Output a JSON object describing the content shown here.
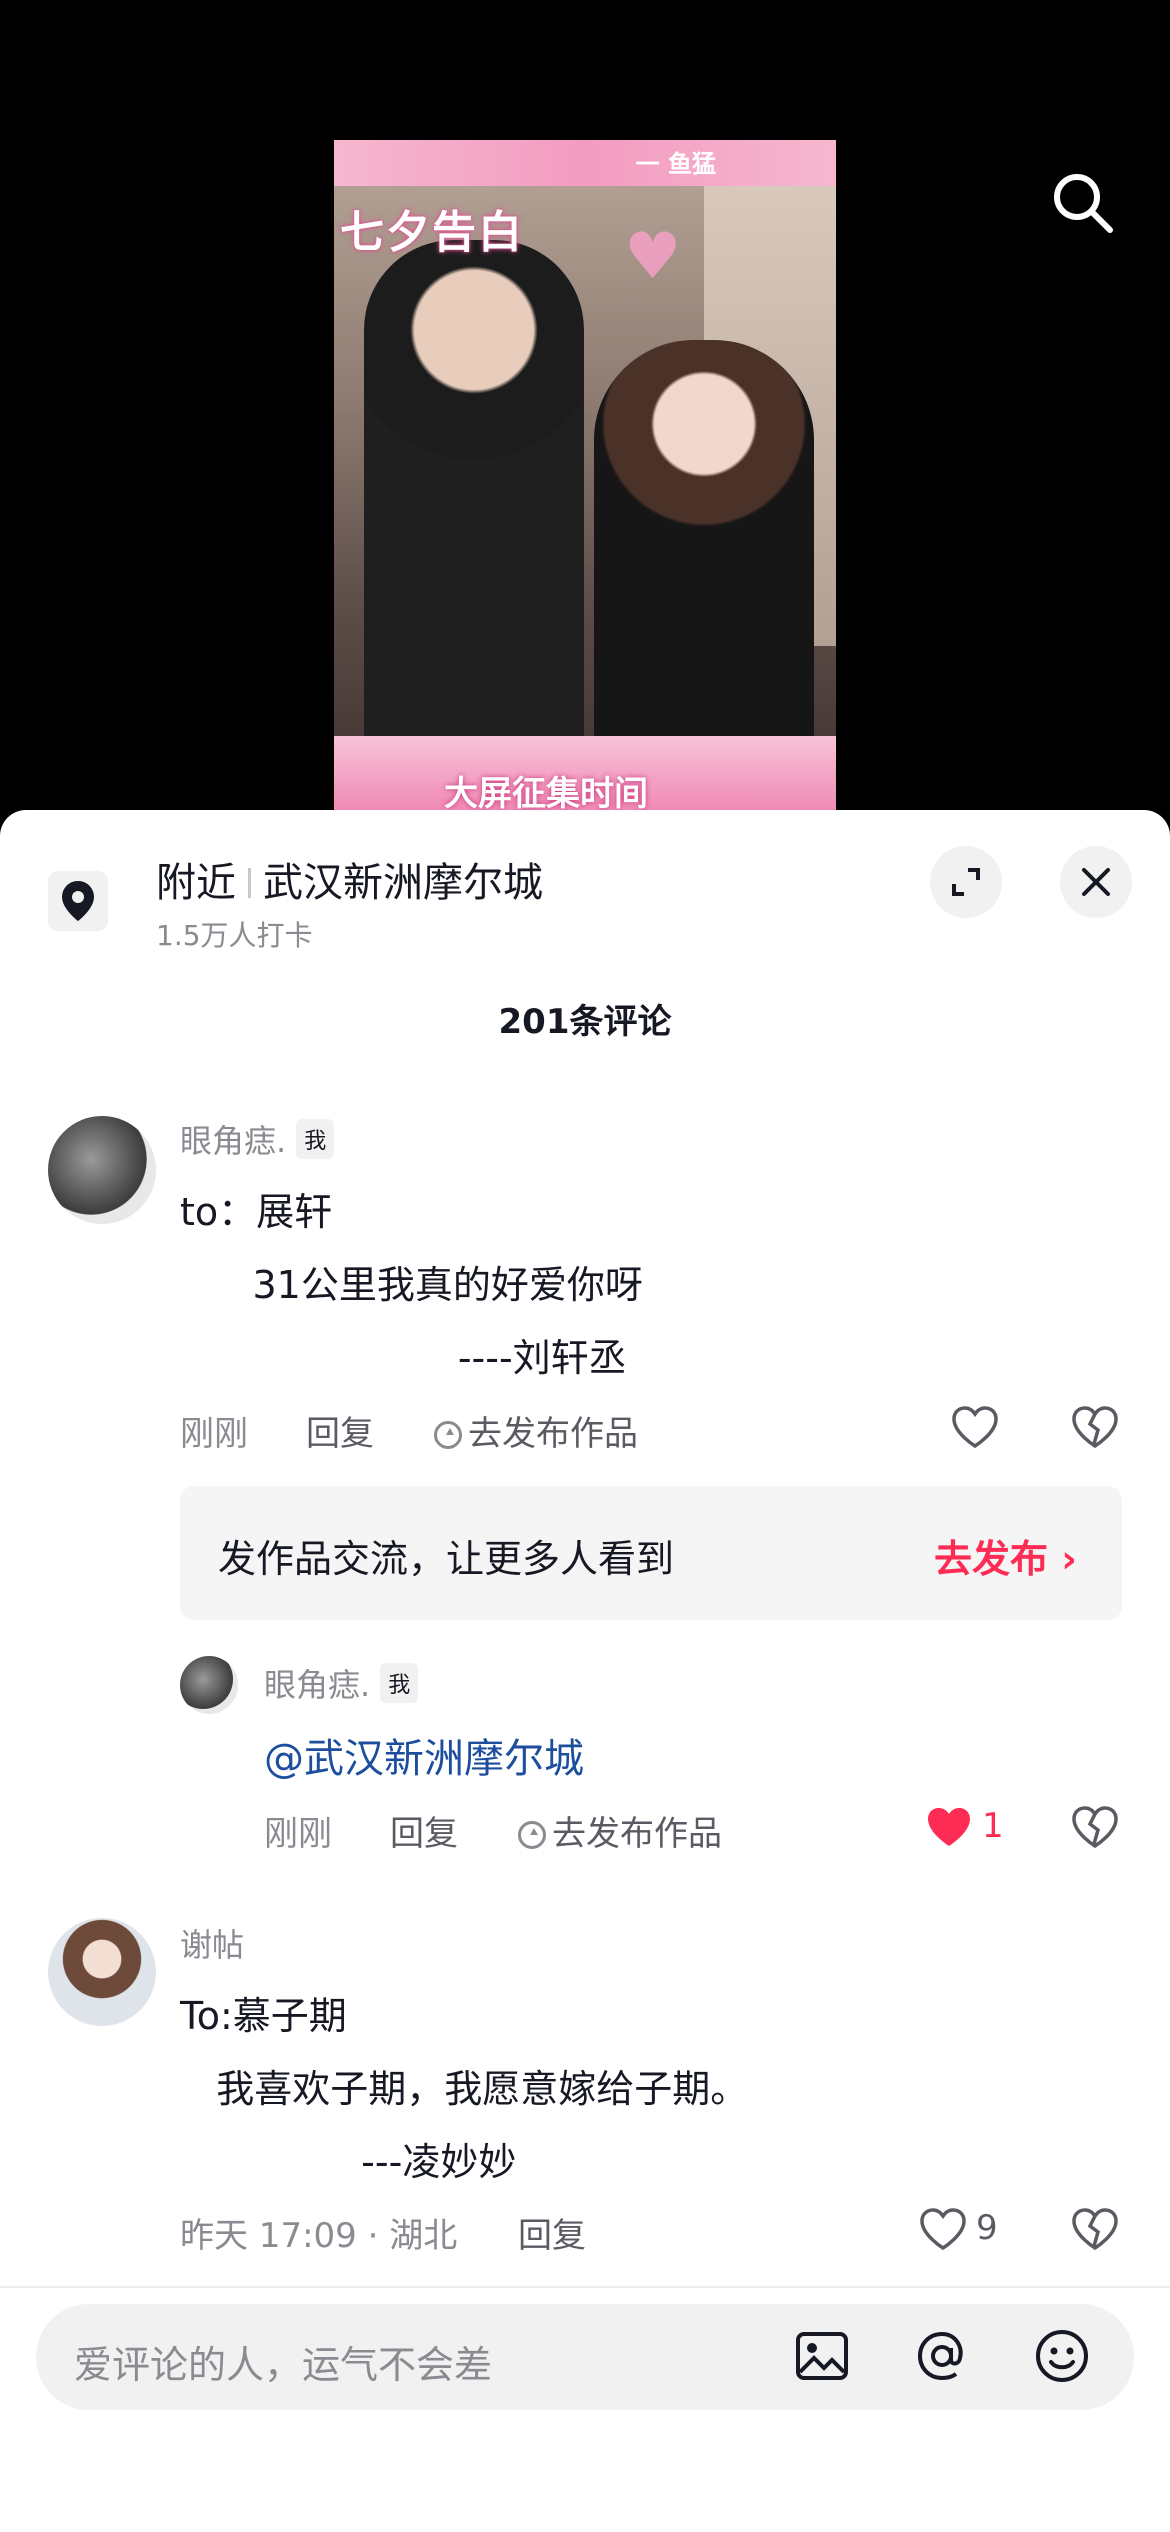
{
  "video": {
    "banner_text": "一 鱼猛",
    "title_text": "七夕告白",
    "bottom_text": "大屏征集时间"
  },
  "location": {
    "prefix": "附近",
    "name": "武汉新洲摩尔城",
    "subtitle": "1.5万人打卡"
  },
  "comments_header": "201条评论",
  "comments": [
    {
      "username": "眼角痣.",
      "badge": "我",
      "lines": [
        "to：展轩",
        "      31公里我真的好爱你呀",
        "                       ----刘轩丞"
      ],
      "time": "刚刚",
      "reply_label": "回复",
      "publish_label": "去发布作品"
    },
    {
      "username": "眼角痣.",
      "badge": "我",
      "mention": "@武汉新洲摩尔城",
      "time": "刚刚",
      "reply_label": "回复",
      "publish_label": "去发布作品",
      "like_count": "1"
    },
    {
      "username": "谢帖",
      "lines": [
        "To:慕子期",
        "   我喜欢子期，我愿意嫁给子期。",
        "               ---凌妙妙"
      ],
      "meta": "昨天 17:09 · 湖北",
      "reply_label": "回复",
      "like_count": "9"
    }
  ],
  "promo": {
    "text": "发作品交流，让更多人看到",
    "link": "去发布 ›"
  },
  "input": {
    "placeholder": "爱评论的人，运气不会差"
  },
  "colors": {
    "accent": "#fe2c55",
    "mention": "#1d4e9e"
  }
}
